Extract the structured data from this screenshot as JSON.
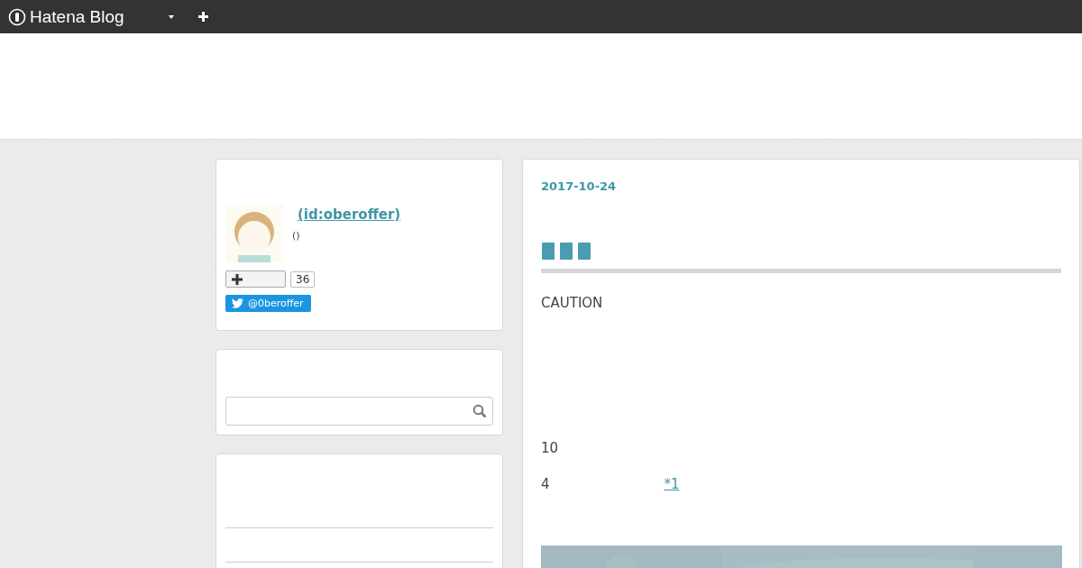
{
  "topbar": {
    "brand": "Hatena Blog"
  },
  "profile": {
    "name": "(id:oberoffer)",
    "description": "()",
    "subscribe_count": "36",
    "twitter": "@0beroffer"
  },
  "entry": {
    "date": "2017-10-24",
    "paragraphs": [
      {
        "text": "CAUTION"
      },
      {
        "text": "10"
      },
      {
        "text": "4",
        "footnote": "*1"
      }
    ]
  }
}
